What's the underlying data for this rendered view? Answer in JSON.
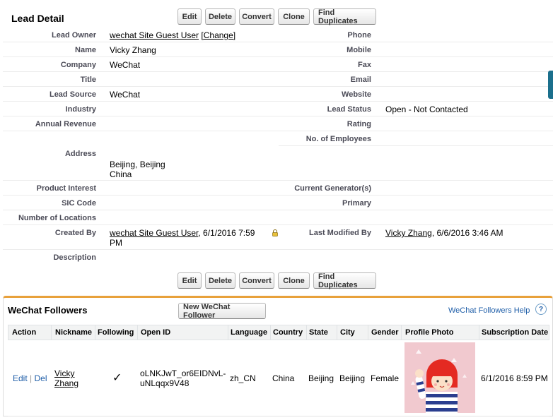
{
  "lead_detail": {
    "title": "Lead Detail",
    "buttons": [
      "Edit",
      "Delete",
      "Convert",
      "Clone",
      "Find Duplicates"
    ],
    "fields_left": {
      "lead_owner": {
        "label": "Lead Owner",
        "value": "wechat Site Guest User",
        "change": "[Change]"
      },
      "name": {
        "label": "Name",
        "value": "Vicky Zhang"
      },
      "company": {
        "label": "Company",
        "value": "WeChat"
      },
      "title": {
        "label": "Title",
        "value": ""
      },
      "lead_source": {
        "label": "Lead Source",
        "value": "WeChat"
      },
      "industry": {
        "label": "Industry",
        "value": ""
      },
      "annual_revenue": {
        "label": "Annual Revenue",
        "value": ""
      },
      "address": {
        "label": "Address",
        "line1": "Beijing, Beijing",
        "line2": "China"
      },
      "product_interest": {
        "label": "Product Interest",
        "value": ""
      },
      "sic_code": {
        "label": "SIC Code",
        "value": ""
      },
      "number_of_locations": {
        "label": "Number of Locations",
        "value": ""
      },
      "created_by": {
        "label": "Created By",
        "user": "wechat Site Guest User",
        "date_line1": ", 6/1/2016 7:59",
        "date_line2": "PM"
      },
      "description": {
        "label": "Description",
        "value": ""
      }
    },
    "fields_right": {
      "phone": {
        "label": "Phone",
        "value": ""
      },
      "mobile": {
        "label": "Mobile",
        "value": ""
      },
      "fax": {
        "label": "Fax",
        "value": ""
      },
      "email": {
        "label": "Email",
        "value": ""
      },
      "website": {
        "label": "Website",
        "value": ""
      },
      "lead_status": {
        "label": "Lead Status",
        "value": "Open - Not Contacted"
      },
      "rating": {
        "label": "Rating",
        "value": ""
      },
      "employees": {
        "label": "No. of Employees",
        "value": ""
      },
      "current_generators": {
        "label": "Current Generator(s)",
        "value": ""
      },
      "primary": {
        "label": "Primary",
        "value": ""
      },
      "last_modified_by": {
        "label": "Last Modified By",
        "user": "Vicky Zhang",
        "date": ", 6/6/2016 3:46 AM"
      }
    }
  },
  "wechat_followers": {
    "title": "WeChat Followers",
    "new_button": "New WeChat Follower",
    "help_link": "WeChat Followers Help",
    "help_icon": "?",
    "columns": [
      "Action",
      "Nickname",
      "Following",
      "Open ID",
      "Language",
      "Country",
      "State",
      "City",
      "Gender",
      "Profile Photo",
      "Subscription Date"
    ],
    "row": {
      "action_edit": "Edit",
      "action_sep": "|",
      "action_del": "Del",
      "nickname_line1": "Vicky",
      "nickname_line2": "Zhang",
      "following": "✓",
      "open_id_line1": "oLNKJwT_or6EIDNvL-",
      "open_id_line2": "uNLqqx9V48",
      "language": "zh_CN",
      "country": "China",
      "state": "Beijing",
      "city": "Beijing",
      "gender": "Female",
      "subscription_date": "6/1/2016 8:59 PM"
    }
  },
  "colors": {
    "accent_border": "#e8a13b",
    "link_blue": "#1f5ea8",
    "photo_bg": "#f1c9cf"
  }
}
